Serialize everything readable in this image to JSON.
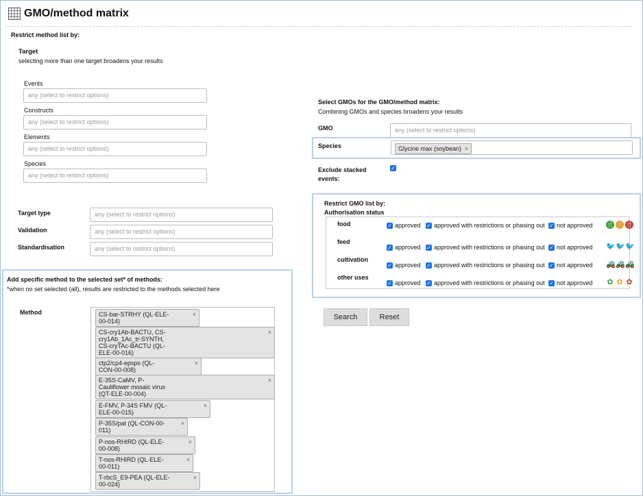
{
  "page": {
    "title": "GMO/method matrix",
    "restrict_heading": "Restrict method list by:"
  },
  "target": {
    "heading": "Target",
    "hint": "selecting more than one target broadens your results",
    "fields": [
      {
        "label": "Events",
        "placeholder": "any (select to restrict options)"
      },
      {
        "label": "Constructs",
        "placeholder": "any (select to restrict options)"
      },
      {
        "label": "Elements",
        "placeholder": "any (select to restrict options)"
      },
      {
        "label": "Species",
        "placeholder": "any (select to restrict options)"
      }
    ]
  },
  "filters": [
    {
      "label": "Target type",
      "placeholder": "any (select to restrict options)"
    },
    {
      "label": "Validation",
      "placeholder": "any (select to restrict options)"
    },
    {
      "label": "Standardisation",
      "placeholder": "any (select to restrict options)"
    }
  ],
  "method_panel": {
    "heading": "Add specific method to the selected set* of methods:",
    "note": "*when no set selected (all), results are restricted to the methods selected here",
    "label": "Method",
    "remove_glyph": "×",
    "tags": [
      [
        "CS-bar-STRHY (QL-ELE-",
        "00-014)"
      ],
      [
        "CS-cry1Ab-BACTU, CS-",
        "cry1Ab_1Ac_tr-SYNTH,",
        "CS-cryTAc-BACTU (QL-",
        "ELE-00-016)"
      ],
      [
        "ctp2/cp4-epsps (QL-",
        "CON-00-008)"
      ],
      [
        "E-35S-CaMV, P-",
        "Cauliflower mosaic virus",
        "(QT-ELE-00-004)"
      ],
      [
        "E-FMV, P-34S FMV (QL-",
        "ELE-00-015)"
      ],
      [
        "P-35S/pat (QL-CON-00-",
        "011)"
      ],
      [
        "P-nos-RHIRD (QL-ELE-",
        "00-008)"
      ],
      [
        "T-nos-RHIRD (QL-ELE-",
        "00-011)"
      ],
      [
        "T-rbcS_E9-PEA (QL-ELE-",
        "00-024)"
      ]
    ]
  },
  "gmo_select": {
    "heading": "Select GMOs for the GMO/method matrix:",
    "hint": "Combining GMOs and species broadens your results",
    "gmo_label": "GMO",
    "gmo_placeholder": "any (select to restrict options)",
    "species_label": "Species",
    "species_tag": "Glycine max (soybean)",
    "exclude_label_1": "Exclude stacked",
    "exclude_label_2": "events:"
  },
  "restrict_gmo": {
    "heading": "Restrict GMO list by:",
    "sub": "Authorisation status",
    "check_glyph": "✓",
    "options": [
      "approved",
      "approved with restrictions or phasing out",
      "not approved"
    ],
    "rows": [
      {
        "label": "food",
        "icon": "fork-knife-icon",
        "glyph": "🍴",
        "colors": [
          "#3aa23a",
          "#f0a020",
          "#d23a2a"
        ]
      },
      {
        "label": "feed",
        "icon": "bird-icon",
        "glyph": "🐦",
        "colors": [
          "#3aa23a",
          "#e0a020",
          "#c0392b"
        ]
      },
      {
        "label": "cultivation",
        "icon": "tractor-icon",
        "glyph": "🚜",
        "colors": [
          "#3aa23a",
          "#e0a020",
          "#d23a2a"
        ]
      },
      {
        "label": "other uses",
        "icon": "flower-icon",
        "glyph": "✿",
        "colors": [
          "#3aa23a",
          "#f0a020",
          "#c0392b"
        ]
      }
    ]
  },
  "buttons": {
    "search": "Search",
    "reset": "Reset"
  }
}
